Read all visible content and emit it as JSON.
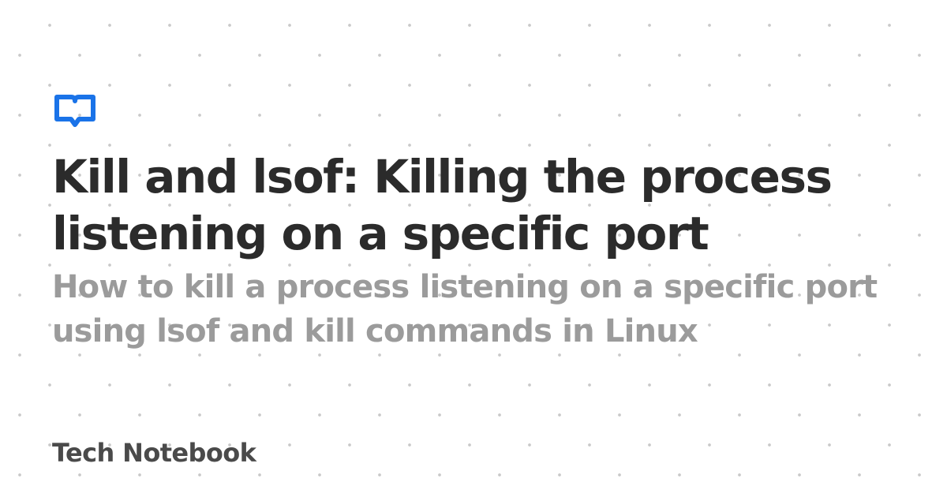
{
  "logo": {
    "icon": "book-icon",
    "color": "#1a73e8"
  },
  "title": "Kill and lsof: Killing the process listening on a specific port",
  "subtitle": "How to kill a process listening on a specific port using lsof and kill commands in Linux",
  "brand": "Tech Notebook"
}
